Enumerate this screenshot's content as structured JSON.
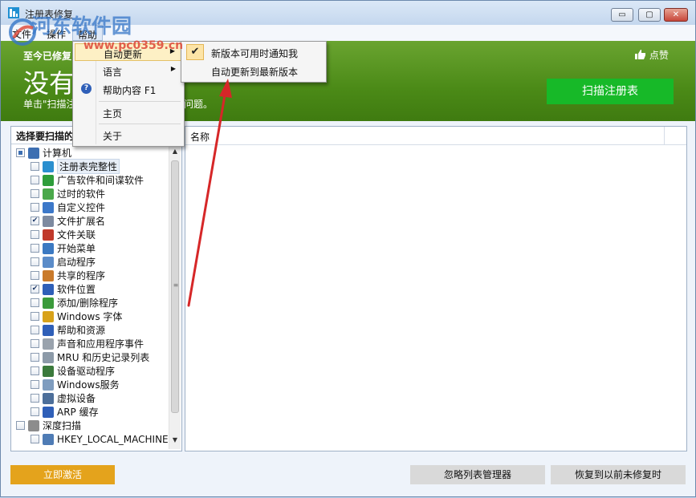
{
  "window": {
    "title": "注册表修复",
    "controls": {
      "minimize": "▭",
      "maximize": "▢",
      "close": "✕"
    }
  },
  "menubar": {
    "file": "文件",
    "operations": "操作",
    "help": "帮助"
  },
  "banner": {
    "line_small": "至今已修复",
    "line_big": "没有",
    "hint_left": "单击\"扫描注",
    "hint_right": "问题。",
    "like_label": "点赞",
    "scan_button": "扫描注册表"
  },
  "left_panel": {
    "header": "选择要扫描的",
    "tree": [
      {
        "label": "计算机",
        "checked": "partial",
        "icon": "computer-icon",
        "color": "#3d6fb2",
        "level": 0
      },
      {
        "label": "注册表完整性",
        "checked": false,
        "icon": "registry-icon",
        "color": "#2a8fcf",
        "level": 1,
        "selected": true
      },
      {
        "label": "广告软件和间谍软件",
        "checked": false,
        "icon": "shield-icon",
        "color": "#2e9d3a",
        "level": 1
      },
      {
        "label": "过时的软件",
        "checked": false,
        "icon": "trash-icon",
        "color": "#4aa84a",
        "level": 1
      },
      {
        "label": "自定义控件",
        "checked": false,
        "icon": "controls-icon",
        "color": "#3c78c9",
        "level": 1
      },
      {
        "label": "文件扩展名",
        "checked": true,
        "icon": "file-extension-icon",
        "color": "#7d8aa0",
        "level": 1
      },
      {
        "label": "文件关联",
        "checked": false,
        "icon": "file-association-icon",
        "color": "#c0392b",
        "level": 1
      },
      {
        "label": "开始菜单",
        "checked": false,
        "icon": "start-menu-icon",
        "color": "#3b79c2",
        "level": 1
      },
      {
        "label": "启动程序",
        "checked": false,
        "icon": "startup-icon",
        "color": "#5b8cc9",
        "level": 1
      },
      {
        "label": "共享的程序",
        "checked": false,
        "icon": "shared-program-icon",
        "color": "#c97a2b",
        "level": 1
      },
      {
        "label": "软件位置",
        "checked": true,
        "icon": "software-location-icon",
        "color": "#2f5fb8",
        "level": 1
      },
      {
        "label": "添加/删除程序",
        "checked": false,
        "icon": "add-remove-icon",
        "color": "#3b9b3b",
        "level": 1
      },
      {
        "label": "Windows 字体",
        "checked": false,
        "icon": "font-icon",
        "color": "#d8a21a",
        "level": 1
      },
      {
        "label": "帮助和资源",
        "checked": false,
        "icon": "help-icon",
        "color": "#2f5fb8",
        "level": 1
      },
      {
        "label": "声音和应用程序事件",
        "checked": false,
        "icon": "sound-icon",
        "color": "#9aa3ad",
        "level": 1
      },
      {
        "label": "MRU 和历史记录列表",
        "checked": false,
        "icon": "history-icon",
        "color": "#8c9aa8",
        "level": 1
      },
      {
        "label": "设备驱动程序",
        "checked": false,
        "icon": "driver-icon",
        "color": "#3b7a3b",
        "level": 1
      },
      {
        "label": "Windows服务",
        "checked": false,
        "icon": "service-icon",
        "color": "#7f9dbf",
        "level": 1
      },
      {
        "label": "虚拟设备",
        "checked": false,
        "icon": "virtual-device-icon",
        "color": "#4d6f9a",
        "level": 1
      },
      {
        "label": "ARP 缓存",
        "checked": false,
        "icon": "arp-cache-icon",
        "color": "#2f5fb8",
        "level": 1
      },
      {
        "label": "深度扫描",
        "checked": false,
        "icon": "deep-scan-icon",
        "color": "#8c8c8c",
        "level": 0
      },
      {
        "label": "HKEY_LOCAL_MACHINE",
        "checked": false,
        "icon": "hive-icon",
        "color": "#4f7cb5",
        "level": 1
      }
    ]
  },
  "right_panel": {
    "column_name": "名称"
  },
  "buttons": {
    "activate": "立即激活",
    "ignore_list": "忽略列表管理器",
    "restore": "恢复到以前未修复时"
  },
  "help_menu": {
    "items": [
      {
        "label": "自动更新",
        "has_submenu": true
      },
      {
        "label": "语言",
        "has_submenu": true
      },
      {
        "label": "帮助内容  F1",
        "icon": "?"
      },
      {
        "label": "主页"
      },
      {
        "label": "关于"
      }
    ]
  },
  "auto_update_submenu": {
    "items": [
      {
        "label": "新版本可用时通知我",
        "checked": true
      },
      {
        "label": "自动更新到最新版本",
        "checked": false
      }
    ]
  },
  "watermark": {
    "brand": "河东软件园",
    "url": "www.pc0359.cn"
  },
  "colors": {
    "banner_green": "#4b8a17",
    "scan_green": "#17b928",
    "activate_orange": "#e4a31c",
    "annotation_arrow": "#d62728"
  }
}
